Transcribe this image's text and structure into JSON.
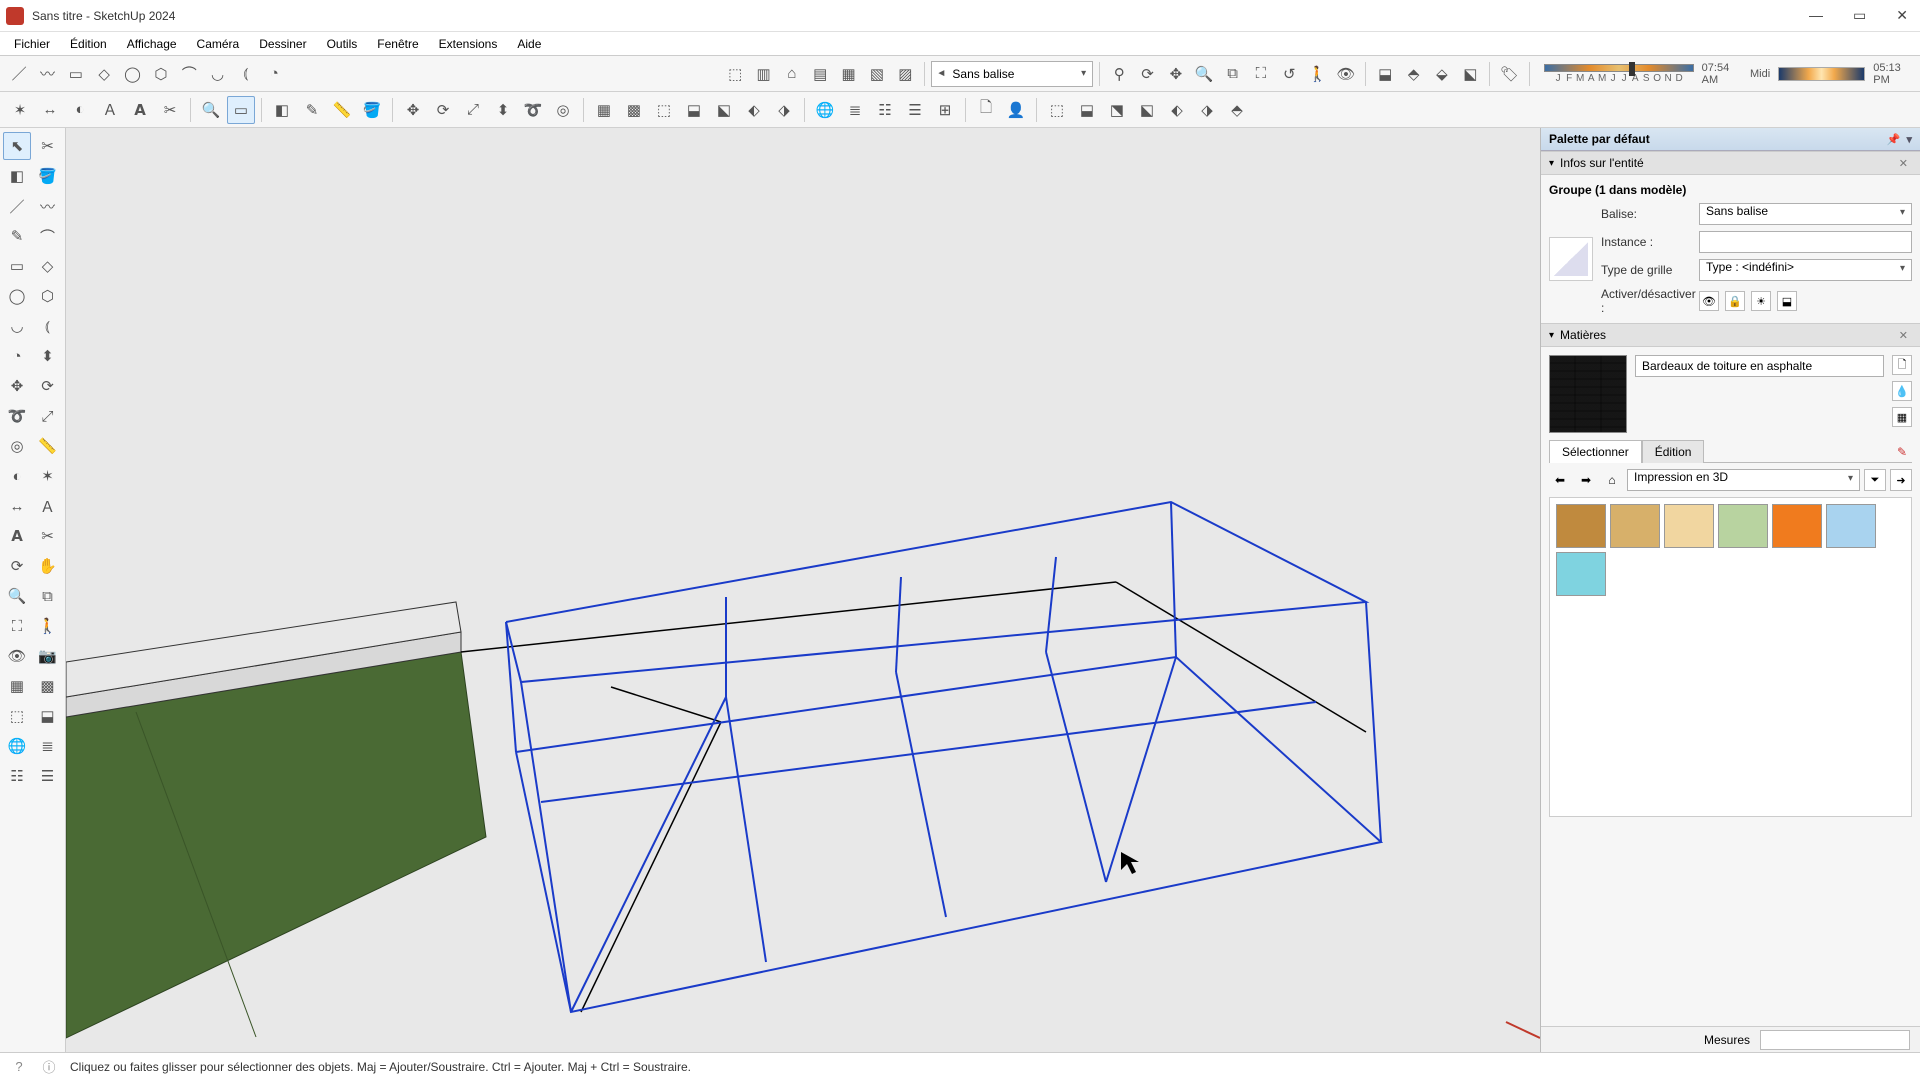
{
  "window": {
    "title": "Sans titre - SketchUp 2024"
  },
  "menu": [
    "Fichier",
    "Édition",
    "Affichage",
    "Caméra",
    "Dessiner",
    "Outils",
    "Fenêtre",
    "Extensions",
    "Aide"
  ],
  "tag_dropdown": "Sans balise",
  "time": {
    "left": "07:54 AM",
    "mid": "Midi",
    "right": "05:13 PM",
    "months": [
      "J",
      "F",
      "M",
      "A",
      "M",
      "J",
      "J",
      "A",
      "S",
      "O",
      "N",
      "D"
    ]
  },
  "tray": {
    "title": "Palette par défaut",
    "entity": {
      "header": "Infos sur l'entité",
      "group_label": "Groupe (1 dans modèle)",
      "labels": {
        "balise": "Balise:",
        "instance": "Instance :",
        "grid": "Type de grille",
        "toggle": "Activer/désactiver :"
      },
      "balise_value": "Sans balise",
      "instance_value": "",
      "grid_value": "Type : <indéfini>"
    },
    "materials": {
      "header": "Matières",
      "current_name": "Bardeaux de toiture en asphalte",
      "tabs": {
        "select": "Sélectionner",
        "edit": "Édition"
      },
      "library": "Impression en 3D",
      "swatches": [
        "#c08a3e",
        "#d7b06a",
        "#f1d6a0",
        "#b8d3a0",
        "#f07b1e",
        "#a9d3ef",
        "#7fd3e0"
      ]
    }
  },
  "measure": {
    "label": "Mesures",
    "value": ""
  },
  "status": {
    "hint": "Cliquez ou faites glisser pour sélectionner des objets. Maj = Ajouter/Soustraire. Ctrl = Ajouter. Maj + Ctrl = Soustraire."
  }
}
